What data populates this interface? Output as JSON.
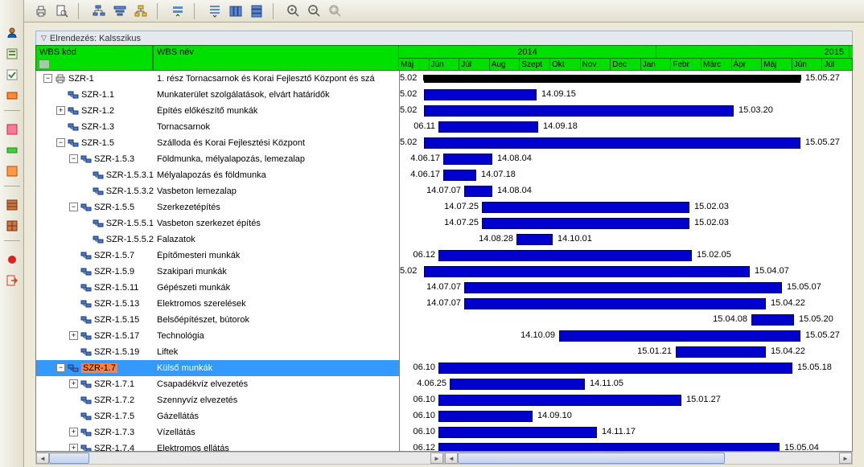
{
  "layout_label": "Elrendezés: Kalsszikus",
  "columns": {
    "code": "WBS kód",
    "name": "WBS név"
  },
  "timeline": {
    "years": [
      "2014",
      "2015"
    ],
    "year_widths": [
      320,
      240
    ],
    "months": [
      "Máj",
      "Jún",
      "Júl",
      "Aug",
      "Szept",
      "Okt",
      "Nov",
      "Dec",
      "Jan",
      "Febr",
      "Márc",
      "Ápr",
      "Máj",
      "Jún",
      "Júl"
    ]
  },
  "rows": [
    {
      "indent": 0,
      "exp": "-",
      "icon": "printer",
      "code": "SZR-1",
      "name": "1. rész Tornacsarnok és Korai Fejlesztő Központ és szá",
      "start_lbl": "5.02",
      "end_lbl": "15.05.27",
      "bar_l": 30,
      "bar_r": 498,
      "summary": true
    },
    {
      "indent": 1,
      "exp": "",
      "icon": "wbs",
      "code": "SZR-1.1",
      "name": "Munkaterület szolgálatások, elvárt határidők",
      "start_lbl": "5.02",
      "end_lbl": "14.09.15",
      "bar_l": 30,
      "bar_r": 170
    },
    {
      "indent": 1,
      "exp": "+",
      "icon": "wbs",
      "code": "SZR-1.2",
      "name": "Építés előkészítő munkák",
      "start_lbl": "5.02",
      "end_lbl": "15.03.20",
      "bar_l": 30,
      "bar_r": 415
    },
    {
      "indent": 1,
      "exp": "",
      "icon": "wbs",
      "code": "SZR-1.3",
      "name": "Tornacsarnok",
      "start_lbl": "06.11",
      "end_lbl": "14.09.18",
      "bar_l": 48,
      "bar_r": 172
    },
    {
      "indent": 1,
      "exp": "-",
      "icon": "wbs",
      "code": "SZR-1.5",
      "name": "Szálloda és Korai Fejlesztési Központ",
      "start_lbl": "5.02",
      "end_lbl": "15.05.27",
      "bar_l": 30,
      "bar_r": 498
    },
    {
      "indent": 2,
      "exp": "-",
      "icon": "wbs",
      "code": "SZR-1.5.3",
      "name": "Földmunka, mélyalapozás, lemezalap",
      "start_lbl": "4.06.17",
      "end_lbl": "14.08.04",
      "bar_l": 54,
      "bar_r": 115
    },
    {
      "indent": 3,
      "exp": "",
      "icon": "wbs",
      "code": "SZR-1.5.3.1",
      "name": "Mélyalapozás és földmunka",
      "start_lbl": "4.06.17",
      "end_lbl": "14.07.18",
      "bar_l": 54,
      "bar_r": 95
    },
    {
      "indent": 3,
      "exp": "",
      "icon": "wbs",
      "code": "SZR-1.5.3.2",
      "name": "Vasbeton lemezalap",
      "start_lbl": "14.07.07",
      "end_lbl": "14.08.04",
      "bar_l": 80,
      "bar_r": 115
    },
    {
      "indent": 2,
      "exp": "-",
      "icon": "wbs",
      "code": "SZR-1.5.5",
      "name": "Szerkezetépítés",
      "start_lbl": "14.07.25",
      "end_lbl": "15.02.03",
      "bar_l": 102,
      "bar_r": 360
    },
    {
      "indent": 3,
      "exp": "",
      "icon": "wbs",
      "code": "SZR-1.5.5.1",
      "name": "Vasbeton szerkezet építés",
      "start_lbl": "14.07.25",
      "end_lbl": "15.02.03",
      "bar_l": 102,
      "bar_r": 360
    },
    {
      "indent": 3,
      "exp": "",
      "icon": "wbs",
      "code": "SZR-1.5.5.2",
      "name": "Falazatok",
      "start_lbl": "14.08.28",
      "end_lbl": "14.10.01",
      "bar_l": 145,
      "bar_r": 190
    },
    {
      "indent": 2,
      "exp": "",
      "icon": "wbs",
      "code": "SZR-1.5.7",
      "name": "Építőmesteri munkák",
      "start_lbl": "06.12",
      "end_lbl": "15.02.05",
      "bar_l": 48,
      "bar_r": 363
    },
    {
      "indent": 2,
      "exp": "",
      "icon": "wbs",
      "code": "SZR-1.5.9",
      "name": "Szakipari munkák",
      "start_lbl": "5.02",
      "end_lbl": "15.04.07",
      "bar_l": 30,
      "bar_r": 435
    },
    {
      "indent": 2,
      "exp": "",
      "icon": "wbs",
      "code": "SZR-1.5.11",
      "name": "Gépészeti munkák",
      "start_lbl": "14.07.07",
      "end_lbl": "15.05.07",
      "bar_l": 80,
      "bar_r": 475
    },
    {
      "indent": 2,
      "exp": "",
      "icon": "wbs",
      "code": "SZR-1.5.13",
      "name": "Elektromos szerelések",
      "start_lbl": "14.07.07",
      "end_lbl": "15.04.22",
      "bar_l": 80,
      "bar_r": 455
    },
    {
      "indent": 2,
      "exp": "",
      "icon": "wbs",
      "code": "SZR-1.5.15",
      "name": "Belsőépítészet, bútorok",
      "start_lbl": "15.04.08",
      "end_lbl": "15.05.20",
      "bar_l": 437,
      "bar_r": 490,
      "lbl_left_shift": true
    },
    {
      "indent": 2,
      "exp": "+",
      "icon": "wbs",
      "code": "SZR-1.5.17",
      "name": "Technológia",
      "start_lbl": "14.10.09",
      "end_lbl": "15.05.27",
      "bar_l": 198,
      "bar_r": 498,
      "lbl_left_shift": true
    },
    {
      "indent": 2,
      "exp": "",
      "icon": "wbs",
      "code": "SZR-1.5.19",
      "name": "Liftek",
      "start_lbl": "15.01.21",
      "end_lbl": "15.04.22",
      "bar_l": 343,
      "bar_r": 455,
      "lbl_left_shift": true
    },
    {
      "indent": 1,
      "exp": "-",
      "icon": "wbs",
      "code": "SZR-1.7",
      "name": "Külső munkák",
      "selected": true,
      "start_lbl": "06.10",
      "end_lbl": "15.05.18",
      "bar_l": 48,
      "bar_r": 488
    },
    {
      "indent": 2,
      "exp": "+",
      "icon": "wbs",
      "code": "SZR-1.7.1",
      "name": "Csapadékvíz elvezetés",
      "start_lbl": "4.06.25",
      "end_lbl": "14.11.05",
      "bar_l": 62,
      "bar_r": 230
    },
    {
      "indent": 2,
      "exp": "",
      "icon": "wbs",
      "code": "SZR-1.7.2",
      "name": "Szennyvíz elvezetés",
      "start_lbl": "06.10",
      "end_lbl": "15.01.27",
      "bar_l": 48,
      "bar_r": 350
    },
    {
      "indent": 2,
      "exp": "",
      "icon": "wbs",
      "code": "SZR-1.7.5",
      "name": "Gázellátás",
      "start_lbl": "06.10",
      "end_lbl": "14.09.10",
      "bar_l": 48,
      "bar_r": 165
    },
    {
      "indent": 2,
      "exp": "+",
      "icon": "wbs",
      "code": "SZR-1.7.3",
      "name": "Vízellátás",
      "start_lbl": "06.10",
      "end_lbl": "14.11.17",
      "bar_l": 48,
      "bar_r": 245
    },
    {
      "indent": 2,
      "exp": "+",
      "icon": "wbs",
      "code": "SZR-1.7.4",
      "name": "Elektromos ellátás",
      "start_lbl": "06.12",
      "end_lbl": "15.05.04",
      "bar_l": 48,
      "bar_r": 472
    }
  ]
}
